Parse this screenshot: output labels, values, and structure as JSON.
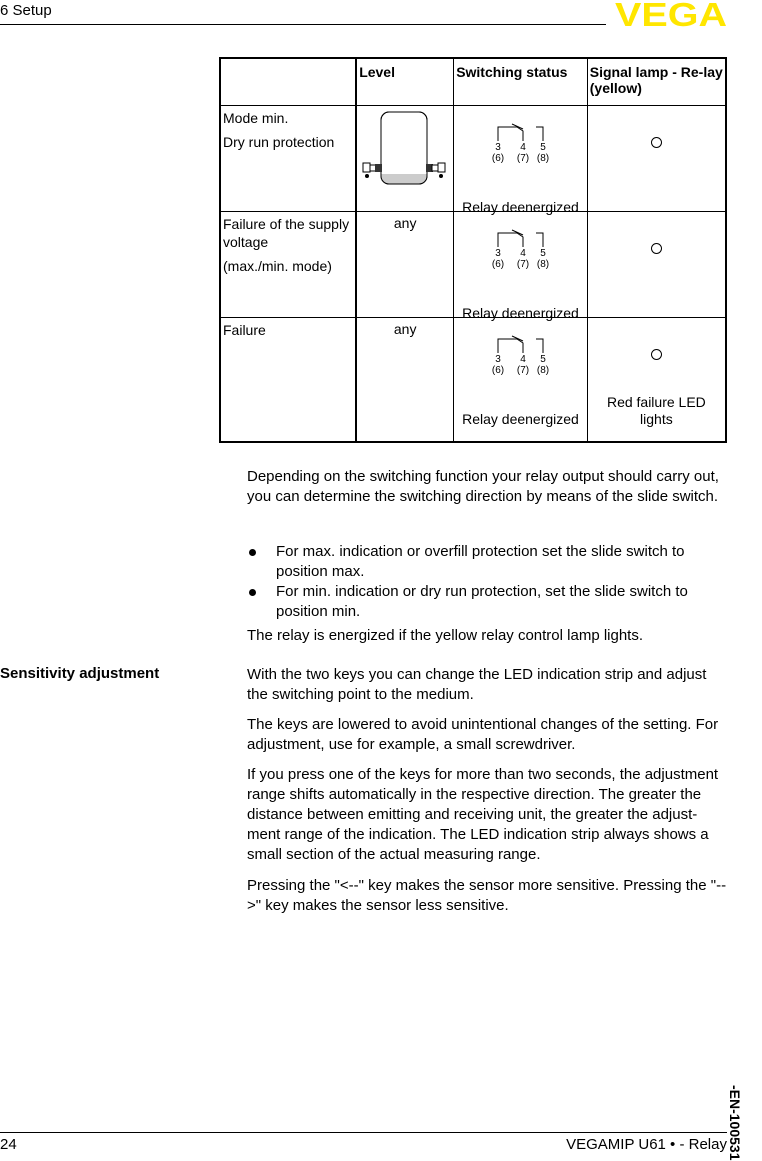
{
  "header": {
    "section_title": "6   Setup",
    "logo_text": "VEGA",
    "logo_color": "#ffe600"
  },
  "table": {
    "headers": [
      "",
      "Level",
      "Switching status",
      "Signal lamp - Re-lay (yellow)"
    ],
    "rows": [
      {
        "condition_lines": [
          "Mode min.",
          "Dry run protection"
        ],
        "level": "",
        "level_icon": "vessel-with-sensors-empty-icon",
        "relay_terminals": [
          "3",
          "4",
          "5"
        ],
        "relay_terminals_alt": [
          "(6)",
          "(7)",
          "(8)"
        ],
        "relay_status": "Relay deenergized",
        "lamp_state": "off",
        "lamp_caption": ""
      },
      {
        "condition_lines": [
          "Failure of the supply voltage",
          "(max./min. mode)"
        ],
        "level": "any",
        "relay_terminals": [
          "3",
          "4",
          "5"
        ],
        "relay_terminals_alt": [
          "(6)",
          "(7)",
          "(8)"
        ],
        "relay_status": "Relay deenergized",
        "lamp_state": "off",
        "lamp_caption": ""
      },
      {
        "condition_lines": [
          "Failure"
        ],
        "level": "any",
        "relay_terminals": [
          "3",
          "4",
          "5"
        ],
        "relay_terminals_alt": [
          "(6)",
          "(7)",
          "(8)"
        ],
        "relay_status": "Relay deenergized",
        "lamp_state": "off",
        "lamp_caption": "Red failure LED lights"
      }
    ]
  },
  "switching": {
    "intro": "Depending on the switching function your relay output should carry out, you can determine the switching direction by means of the slide switch.",
    "bullets": [
      "For max. indication or overfill protection set the slide switch to position max.",
      "For min. indication or  dry run protection, set the slide switch to position min."
    ],
    "note": "The relay is energized if the yellow relay control lamp lights."
  },
  "sensitivity": {
    "heading": "Sensitivity adjustment",
    "paragraphs": [
      "With the two keys you can change the LED indication strip and adjust the switching point to the medium.",
      "The keys are lowered to avoid unintentional changes of the setting. For adjustment, use for example, a small screwdriver.",
      "If you press one of the keys for more than two seconds, the adjustment range shifts automatically in the respective direction. The greater the distance between emitting and receiving unit, the greater the adjust-ment range of the indication. The LED indication strip always shows a small section of the actual measuring range.",
      "Pressing the \"<--\" key makes the sensor more sensitive.  Pressing the \"-->\" key makes the sensor less sensitive."
    ]
  },
  "footer": {
    "page_number": "24",
    "product": "VEGAMIP U61 • - Relay",
    "doc_id": "-EN-100531"
  }
}
